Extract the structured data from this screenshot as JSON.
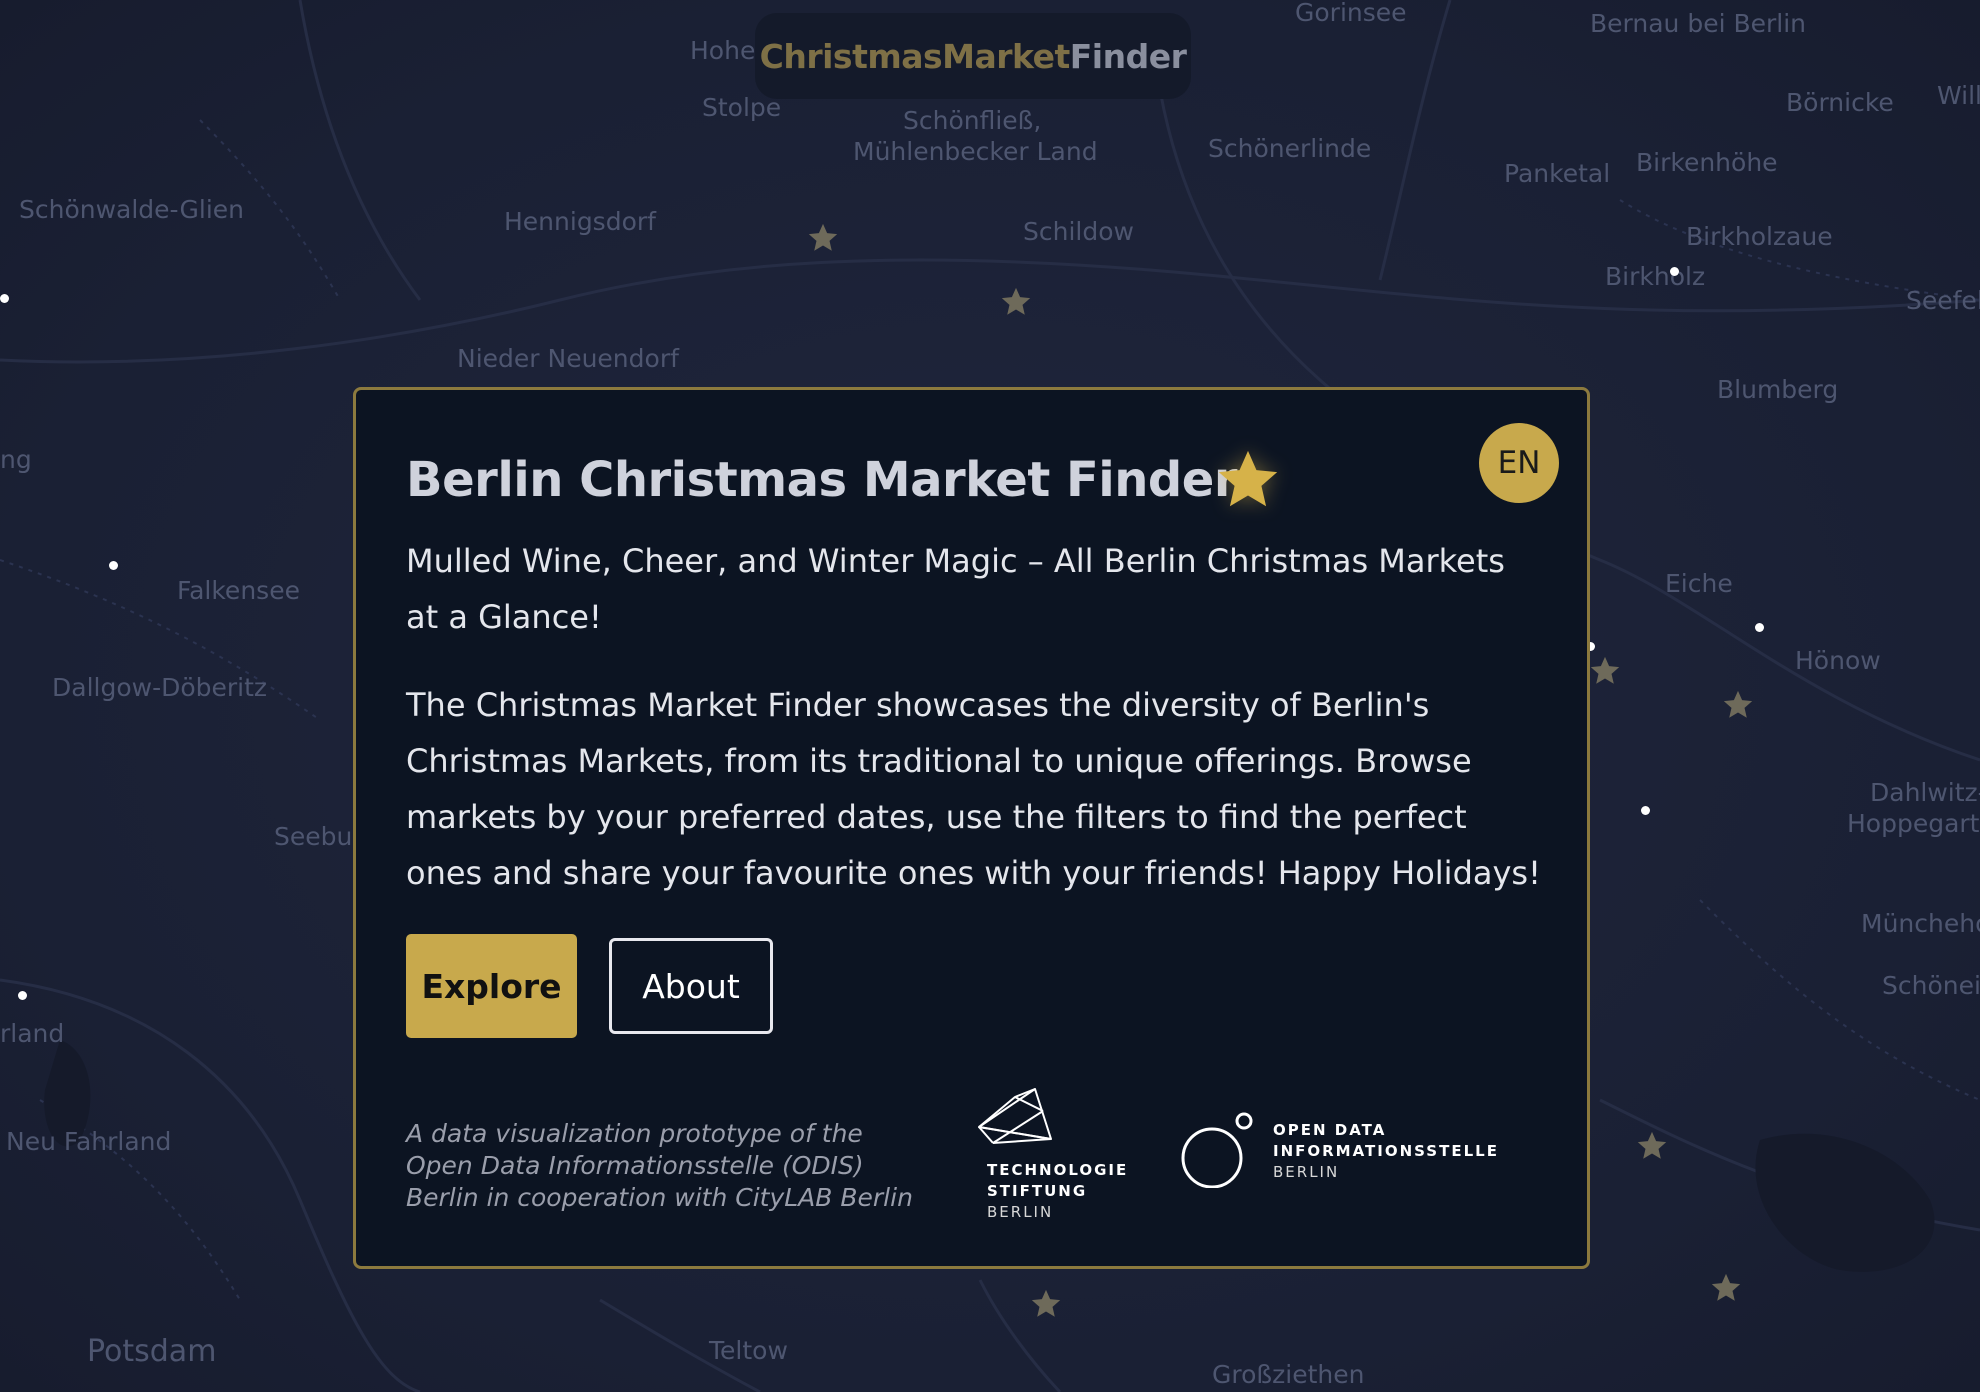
{
  "brand": {
    "part1": "ChristmasMarket",
    "part2": "Finder",
    "accent": "#c8a94c"
  },
  "dialog": {
    "title": "Berlin Christmas Market Finder",
    "title_icon": "star-icon",
    "language": "EN",
    "subtitle": "Mulled Wine, Cheer, and Winter Magic – All Berlin Christmas Markets at a Glance!",
    "body": "The Christmas Market Finder showcases the diversity of Berlin's Christmas Markets, from its traditional to unique offerings. Browse markets by your preferred dates, use the filters to find the perfect ones and share your favourite ones with your friends! Happy Holidays!",
    "explore_label": "Explore",
    "about_label": "About",
    "credit": "A data visualization prototype of the Open Data Informationsstelle (ODIS) Berlin in cooperation with CityLAB Berlin",
    "logo_tsb": {
      "line1": "TECHNOLOGIE",
      "line2": "STIFTUNG",
      "line3": "BERLIN"
    },
    "logo_odis": {
      "line1": "OPEN DATA",
      "line2": "INFORMATIONSSTELLE",
      "line3": "BERLIN"
    }
  },
  "map": {
    "places": {
      "gorinsee": "Gorinsee",
      "bernau": "Bernau bei Berlin",
      "hohe": "Hohe",
      "stolpe": "Stolpe",
      "schoenfliess": "Schönfließ,",
      "muehlenbecker": "Mühlenbecker Land",
      "schoenerlinde": "Schönerlinde",
      "boernicke": "Börnicke",
      "willme": "Willme",
      "panketal": "Panketal",
      "birkenhoehe": "Birkenhöhe",
      "schoenwalde": "Schönwalde-Glien",
      "hennigsdorf": "Hennigsdorf",
      "schildow": "Schildow",
      "birkholzaue": "Birkholzaue",
      "birkholz": "Birkholz",
      "seefeld": "Seefel",
      "nieder_neuendorf": "Nieder Neuendorf",
      "blumberg": "Blumberg",
      "ng": "ng",
      "falkensee": "Falkensee",
      "eiche": "Eiche",
      "hoenow": "Hönow",
      "dallgow": "Dallgow-Döberitz",
      "dahlwitz1": "Dahlwitz-",
      "dahlwitz2": "Hoppegarte",
      "seebur": "Seebur",
      "muenchehofe": "Münchehof",
      "schoeneiche": "Schöneic",
      "rland": "rland",
      "neu_fahrland": "Neu Fahrland",
      "potsdam": "Potsdam",
      "teltow": "Teltow",
      "grossziethen": "Großziethen"
    }
  }
}
